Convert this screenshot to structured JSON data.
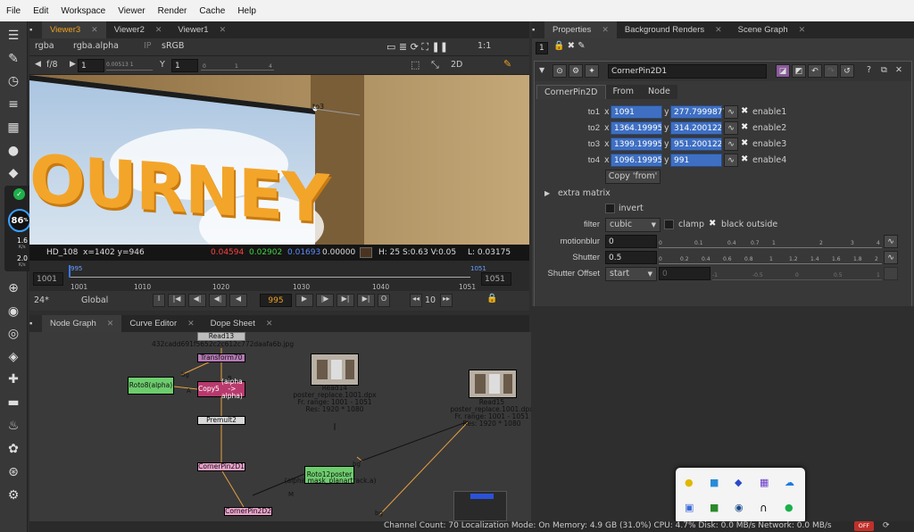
{
  "menubar": {
    "items": [
      "File",
      "Edit",
      "Workspace",
      "Viewer",
      "Render",
      "Cache",
      "Help"
    ]
  },
  "viewer_tabs": [
    {
      "label": "Viewer3"
    },
    {
      "label": "Viewer2"
    },
    {
      "label": "Viewer1"
    }
  ],
  "viewer_bar": {
    "channels": "rgba",
    "alpha": "rgba.alpha",
    "ip": "IP",
    "lut": "sRGB",
    "scale": "1:1"
  },
  "viewer_bar2": {
    "fstop": "f/8",
    "gain_val": "1",
    "gain_range": "0.00513 1",
    "gamma_label": "Y",
    "gamma_val": "1",
    "gamma_ticks": [
      "0",
      "1",
      "4"
    ],
    "view": "2D"
  },
  "viewer": {
    "point_label": "to3",
    "text_logo": "OURNEY"
  },
  "info_bar": {
    "format": "HD_108",
    "coords": "x=1402 y=946",
    "r": "0.04594",
    "g": "0.02902",
    "b": "0.01693",
    "a": "0.00000",
    "hsv": "H: 25 S:0.63 V:0.05",
    "lum": "L: 0.03175"
  },
  "timeline": {
    "start": "1001",
    "end": "1051",
    "ticks": [
      "1001",
      "1010",
      "1020",
      "1030",
      "1040",
      "1051"
    ],
    "marker_start": "995",
    "marker_end": "1051"
  },
  "playback": {
    "fps": "24*",
    "scope": "Global",
    "frame": "995",
    "step": "10"
  },
  "graph_tabs": [
    {
      "label": "Node Graph"
    },
    {
      "label": "Curve Editor"
    },
    {
      "label": "Dope Sheet"
    }
  ],
  "nodes": {
    "read13": {
      "label": "Read13",
      "sub": "432cadd691f5652c2c612c772daafa6b.jpg"
    },
    "transform70": {
      "label": "Transform70"
    },
    "roto8": {
      "label": "Roto8",
      "sub": "(alpha)"
    },
    "copy5": {
      "label": "Copy5",
      "sub": "(alpha -> alpha)"
    },
    "premult2": {
      "label": "Premult2"
    },
    "cornerpin1": {
      "label": "CornerPin2D1"
    },
    "cornerpin2": {
      "label": "CornerPin2D2"
    },
    "read14": {
      "label": "Read14",
      "l1": "poster_replace.1001.dpx",
      "l2": "Fr. range: 1001 - 1051",
      "l3": "Res: 1920 * 1080"
    },
    "read15": {
      "label": "Read15",
      "l1": "poster_replace.1001.dpx",
      "l2": "Fr. range: 1001 - 1051",
      "l3": "Res: 1920 * 1080"
    },
    "roto12": {
      "label": "Roto12poster",
      "sub": "(alpha mask_planartrack.a)"
    },
    "pipe_labels": {
      "bg": "bg",
      "a": "A",
      "b": "B",
      "bg2": "bg",
      "m": "M",
      "bg3": "bg"
    }
  },
  "status": {
    "text": "Channel Count: 70  Localization Mode: On  Memory: 4.9 GB (31.0%) CPU: 4.7% Disk: 0.0 MB/s Network: 0.0 MB/s",
    "badge": "OFF"
  },
  "overlay": {
    "percent": "86",
    "pct_sign": "%",
    "up_val": "1.6",
    "up_unit": "K/s",
    "down_val": "2.0",
    "down_unit": "K/s"
  },
  "properties_tabs": [
    {
      "label": "Properties"
    },
    {
      "label": "Background Renders"
    },
    {
      "label": "Scene Graph"
    }
  ],
  "properties": {
    "count": "1",
    "node_name": "CornerPin2D",
    "node_name_field": "CornerPin2D1",
    "subtabs": [
      "CornerPin2D",
      "From",
      "Node"
    ],
    "rows": [
      {
        "label": "to1",
        "x": "1091",
        "y": "277.7999877",
        "enable": "enable1"
      },
      {
        "label": "to2",
        "x": "1364.199951",
        "y": "314.2001221",
        "enable": "enable2"
      },
      {
        "label": "to3",
        "x": "1399.199951",
        "y": "951.2001221",
        "enable": "enable3"
      },
      {
        "label": "to4",
        "x": "1096.199951",
        "y": "991",
        "enable": "enable4"
      }
    ],
    "xl": "x",
    "yl": "y",
    "copy_from": "Copy 'from'",
    "extra_matrix": "extra matrix",
    "invert": "invert",
    "filter_label": "filter",
    "filter_value": "cubic",
    "clamp": "clamp",
    "black_outside": "black outside",
    "motionblur_label": "motionblur",
    "motionblur_value": "0",
    "mb_ticks": [
      "0",
      "0.1",
      "0.4",
      "0.7",
      "1",
      "2",
      "3",
      "4"
    ],
    "shutter_label": "Shutter",
    "shutter_value": "0.5",
    "sh_ticks": [
      "0",
      "0.2",
      "0.4",
      "0.6",
      "0.8",
      "1",
      "1.2",
      "1.4",
      "1.6",
      "1.8",
      "2"
    ],
    "offset_label": "Shutter Offset",
    "offset_value": "start",
    "offset_num": "0",
    "off_ticks": [
      "-1",
      "-0.5",
      "0",
      "0.5",
      "1"
    ]
  }
}
